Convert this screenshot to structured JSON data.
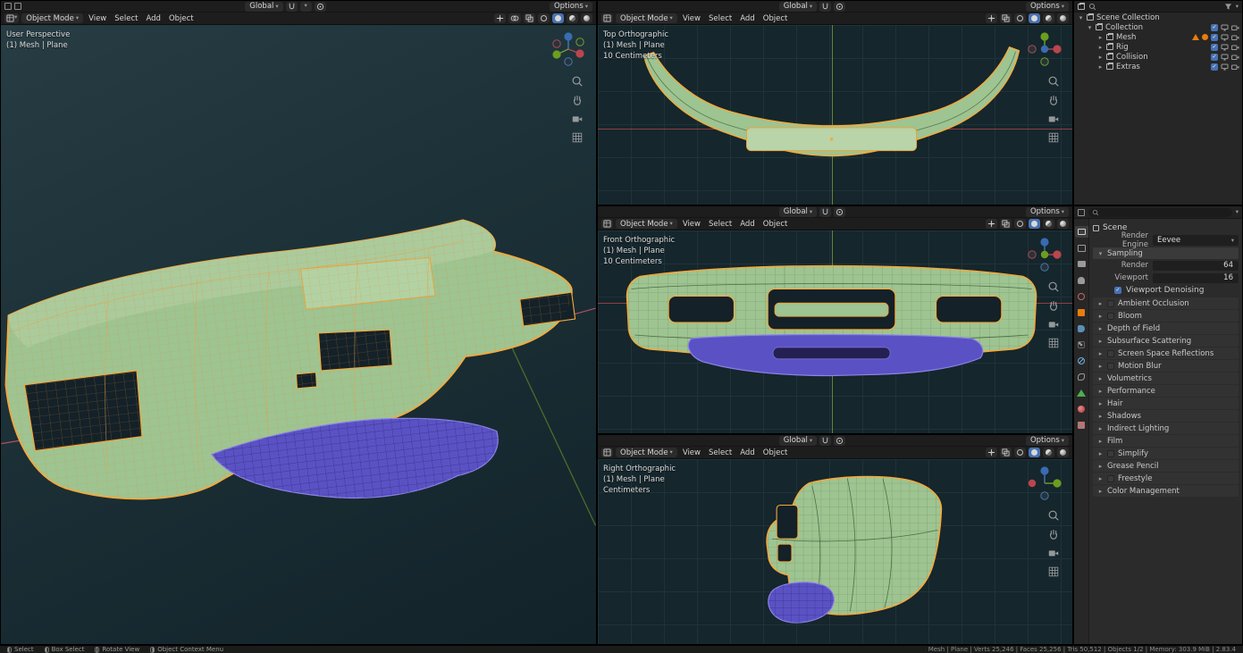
{
  "colors": {
    "accent_blue": "#4772b3",
    "mesh_green": "#9ec491",
    "wire_orange": "#f5a93c",
    "valance_purple": "#5a52c4",
    "axis_red": "#c4474f",
    "axis_green": "#82a52d",
    "axis_z_blue": "#3b6fb8",
    "blender_orange": "#e87d0d"
  },
  "header": {
    "mode": "Object Mode",
    "menu_view": "View",
    "menu_select": "Select",
    "menu_add": "Add",
    "menu_object": "Object",
    "orientation": "Global",
    "options": "Options"
  },
  "viewports": {
    "perspective": {
      "line1": "User Perspective",
      "line2": "(1) Mesh | Plane"
    },
    "top": {
      "line1": "Top Orthographic",
      "line2": "(1) Mesh | Plane",
      "line3": "10 Centimeters"
    },
    "front": {
      "line1": "Front Orthographic",
      "line2": "(1) Mesh | Plane",
      "line3": "10 Centimeters"
    },
    "right": {
      "line1": "Right Orthographic",
      "line2": "(1) Mesh | Plane",
      "line3": "Centimeters"
    }
  },
  "outliner": {
    "root": "Scene Collection",
    "items": [
      {
        "label": "Collection"
      },
      {
        "label": "Mesh"
      },
      {
        "label": "Rig"
      },
      {
        "label": "Collision"
      },
      {
        "label": "Extras"
      }
    ]
  },
  "properties": {
    "breadcrumb": "Scene",
    "render_engine_label": "Render Engine",
    "render_engine_value": "Eevee",
    "sampling": {
      "title": "Sampling",
      "render_label": "Render",
      "render_value": "64",
      "viewport_label": "Viewport",
      "viewport_value": "16",
      "denoise_label": "Viewport Denoising"
    },
    "sections": [
      {
        "label": "Ambient Occlusion"
      },
      {
        "label": "Bloom"
      },
      {
        "label": "Depth of Field"
      },
      {
        "label": "Subsurface Scattering"
      },
      {
        "label": "Screen Space Reflections"
      },
      {
        "label": "Motion Blur"
      },
      {
        "label": "Volumetrics"
      },
      {
        "label": "Performance"
      },
      {
        "label": "Hair"
      },
      {
        "label": "Shadows"
      },
      {
        "label": "Indirect Lighting"
      },
      {
        "label": "Film"
      },
      {
        "label": "Simplify"
      },
      {
        "label": "Grease Pencil"
      },
      {
        "label": "Freestyle"
      },
      {
        "label": "Color Management"
      }
    ]
  },
  "statusbar": {
    "select": "Select",
    "box_select": "Box Select",
    "rotate_view": "Rotate View",
    "context_menu": "Object Context Menu",
    "stats": "Mesh | Plane | Verts 25,246 | Faces 25,256 | Tris 50,512 | Objects 1/2 | Memory: 303.9 MiB | 2.83.4"
  }
}
